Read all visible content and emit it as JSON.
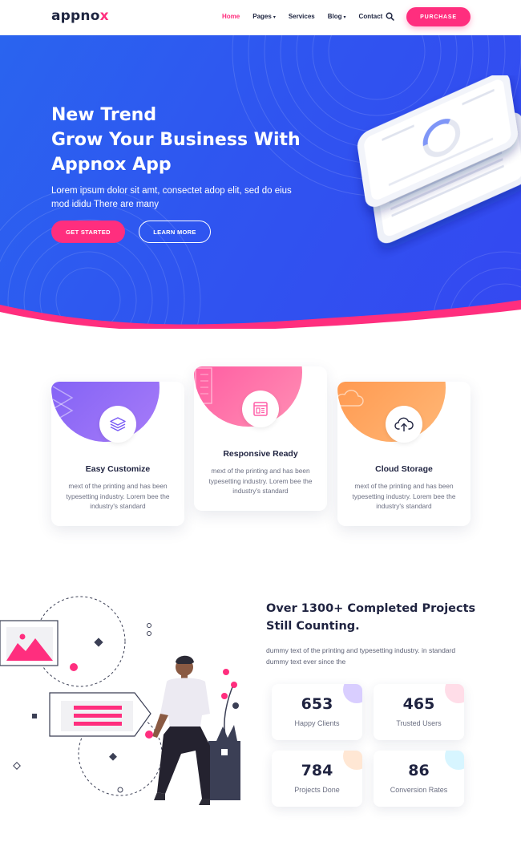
{
  "brand": {
    "logo_text": "appno",
    "logo_x": "x",
    "accent": "#ff2e7e",
    "primary": "#2f55f0"
  },
  "nav": {
    "items": [
      {
        "label": "Home",
        "active": true,
        "dropdown": false
      },
      {
        "label": "Pages",
        "active": false,
        "dropdown": true
      },
      {
        "label": "Services",
        "active": false,
        "dropdown": false
      },
      {
        "label": "Blog",
        "active": false,
        "dropdown": true
      },
      {
        "label": "Contact",
        "active": false,
        "dropdown": false
      }
    ],
    "caret": "▾",
    "search_icon": "search-icon",
    "purchase_label": "PURCHASE"
  },
  "hero": {
    "title_line1": "New Trend",
    "title_line2": "Grow Your Business With",
    "title_line3": "Appnox App",
    "text": "Lorem ipsum dolor sit amt, consectet adop elit, sed do eius mod ididu There are many",
    "btn_primary": "GET STARTED",
    "btn_secondary": "LEARN MORE"
  },
  "features": [
    {
      "title": "Easy Customize",
      "text": "mext of the printing and has been typesetting industry. Lorem bee the industry's standard",
      "icon": "layers-icon",
      "color_from": "#7a5cf5",
      "color_to": "#a77cf8"
    },
    {
      "title": "Responsive Ready",
      "text": "mext of the printing and has been typesetting industry. Lorem bee the industry's standard",
      "icon": "browser-icon",
      "color_from": "#ff5ea8",
      "color_to": "#ff8bb0"
    },
    {
      "title": "Cloud Storage",
      "text": "mext of the printing and has been typesetting industry. Lorem bee the industry's standard",
      "icon": "cloud-upload-icon",
      "color_from": "#ff9a4d",
      "color_to": "#ffb877"
    }
  ],
  "stats": {
    "title_line1": "Over 1300+ Completed Projects",
    "title_line2": "Still Counting.",
    "text": "dummy text of the printing and typesetting industry. in standard dummy text ever since the",
    "items": [
      {
        "value": "653",
        "label": "Happy Clients",
        "corner": "#b9a6ff"
      },
      {
        "value": "465",
        "label": "Trusted Users",
        "corner": "#ffc1d6"
      },
      {
        "value": "784",
        "label": "Projects Done",
        "corner": "#ffd3b0"
      },
      {
        "value": "86",
        "label": "Conversion Rates",
        "corner": "#b7ecff"
      }
    ]
  }
}
